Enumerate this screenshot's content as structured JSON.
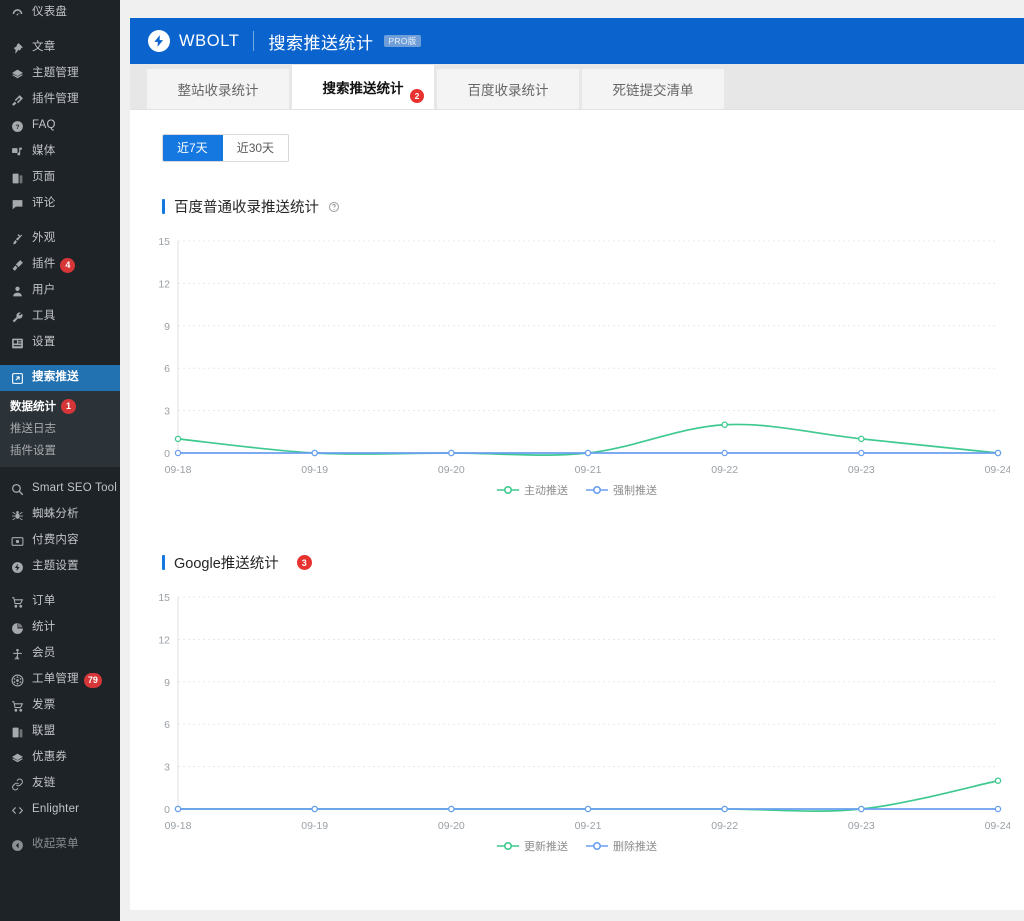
{
  "sidebar": {
    "items": [
      {
        "label": "仪表盘",
        "icon": "dashboard-icon",
        "group": 0
      },
      {
        "label": "文章",
        "icon": "pin-icon",
        "group": 1
      },
      {
        "label": "主题管理",
        "icon": "layers-icon",
        "group": 1
      },
      {
        "label": "插件管理",
        "icon": "plug-icon",
        "group": 1
      },
      {
        "label": "FAQ",
        "icon": "question-icon",
        "group": 1
      },
      {
        "label": "媒体",
        "icon": "media-icon",
        "group": 1
      },
      {
        "label": "页面",
        "icon": "page-icon",
        "group": 1
      },
      {
        "label": "评论",
        "icon": "comment-icon",
        "group": 1
      },
      {
        "label": "外观",
        "icon": "brush-icon",
        "group": 2
      },
      {
        "label": "插件",
        "icon": "plugin-icon",
        "badge": "4",
        "group": 2
      },
      {
        "label": "用户",
        "icon": "user-icon",
        "group": 2
      },
      {
        "label": "工具",
        "icon": "wrench-icon",
        "group": 2
      },
      {
        "label": "设置",
        "icon": "settings-icon",
        "group": 2
      },
      {
        "label": "搜索推送",
        "icon": "push-icon",
        "active": true,
        "group": 3
      },
      {
        "label": "Smart SEO Tool",
        "icon": "seo-icon",
        "group": 4
      },
      {
        "label": "蜘蛛分析",
        "icon": "spider-icon",
        "group": 4
      },
      {
        "label": "付费内容",
        "icon": "eye-icon",
        "group": 4
      },
      {
        "label": "主题设置",
        "icon": "bolt-icon",
        "group": 4
      },
      {
        "label": "订单",
        "icon": "cart-icon",
        "group": 5
      },
      {
        "label": "统计",
        "icon": "chart-pie-icon",
        "group": 5
      },
      {
        "label": "会员",
        "icon": "member-icon",
        "group": 5
      },
      {
        "label": "工单管理",
        "icon": "ticket-icon",
        "badge": "79",
        "group": 5
      },
      {
        "label": "发票",
        "icon": "cart-icon",
        "group": 5
      },
      {
        "label": "联盟",
        "icon": "page-icon",
        "group": 5
      },
      {
        "label": "优惠券",
        "icon": "layers-icon",
        "group": 5
      },
      {
        "label": "友链",
        "icon": "link-icon",
        "group": 5
      },
      {
        "label": "Enlighter",
        "icon": "code-icon",
        "group": 5
      },
      {
        "label": "收起菜单",
        "icon": "collapse-icon",
        "dim": true,
        "group": 6
      }
    ],
    "submenu": [
      {
        "label": "数据统计",
        "active": true,
        "badge": "1"
      },
      {
        "label": "推送日志",
        "active": false
      },
      {
        "label": "插件设置",
        "active": false
      }
    ]
  },
  "header": {
    "brand": "WBOLT",
    "title": "搜索推送统计",
    "pro_badge": "PRO版",
    "logo_icon": "bolt-logo-icon",
    "accent_color": "#0b63ce"
  },
  "tabs": [
    {
      "label": "整站收录统计",
      "active": false
    },
    {
      "label": "搜索推送统计",
      "active": true,
      "badge": "2"
    },
    {
      "label": "百度收录统计",
      "active": false
    },
    {
      "label": "死链提交清单",
      "active": false
    }
  ],
  "range_buttons": [
    {
      "label": "近7天",
      "active": true
    },
    {
      "label": "近30天",
      "active": false
    }
  ],
  "sections": [
    {
      "title": "百度普通收录推送统计",
      "help_icon": "question-circle-icon",
      "badge": null
    },
    {
      "title": "Google推送统计",
      "help_icon": null,
      "badge": "3"
    }
  ],
  "colors": {
    "green": "#3ec98f",
    "blue": "#6a9ff0",
    "header_blue": "#0b63ce",
    "accent_blue": "#1478e0",
    "badge_red": "#e8322f",
    "sidebar_bg": "#1d2327"
  },
  "chart_data": [
    {
      "type": "line",
      "title": "百度普通收录推送统计",
      "categories": [
        "09-18",
        "09-19",
        "09-20",
        "09-21",
        "09-22",
        "09-23",
        "09-24"
      ],
      "series": [
        {
          "name": "主动推送",
          "color": "#3ec98f",
          "values": [
            1,
            0,
            0,
            0,
            2,
            1,
            0
          ]
        },
        {
          "name": "强制推送",
          "color": "#6a9ff0",
          "values": [
            0,
            0,
            0,
            0,
            0,
            0,
            0
          ]
        }
      ],
      "xlabel": "",
      "ylabel": "",
      "yticks": [
        0,
        3,
        6,
        9,
        12,
        15
      ],
      "ylim": [
        0,
        15
      ],
      "grid": true,
      "legend_position": "bottom"
    },
    {
      "type": "line",
      "title": "Google推送统计",
      "categories": [
        "09-18",
        "09-19",
        "09-20",
        "09-21",
        "09-22",
        "09-23",
        "09-24"
      ],
      "series": [
        {
          "name": "更新推送",
          "color": "#3ec98f",
          "values": [
            0,
            0,
            0,
            0,
            0,
            0,
            2
          ]
        },
        {
          "name": "删除推送",
          "color": "#6a9ff0",
          "values": [
            0,
            0,
            0,
            0,
            0,
            0,
            0
          ]
        }
      ],
      "xlabel": "",
      "ylabel": "",
      "yticks": [
        0,
        3,
        6,
        9,
        12,
        15
      ],
      "ylim": [
        0,
        15
      ],
      "grid": true,
      "legend_position": "bottom"
    }
  ]
}
